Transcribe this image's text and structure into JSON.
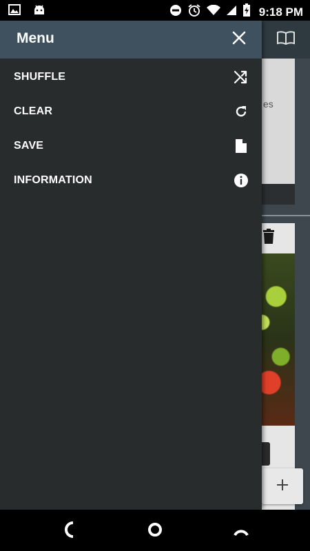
{
  "status_bar": {
    "time": "9:18 PM",
    "left_icons": [
      "image-icon",
      "android-icon"
    ],
    "right_icons": [
      "do-not-disturb-icon",
      "alarm-icon",
      "wifi-icon",
      "signal-icon",
      "battery-icon"
    ]
  },
  "drawer": {
    "title": "Menu",
    "close_icon": "close-icon",
    "items": [
      {
        "label": "SHUFFLE",
        "icon": "shuffle-icon"
      },
      {
        "label": "CLEAR",
        "icon": "refresh-icon"
      },
      {
        "label": "SAVE",
        "icon": "file-icon"
      },
      {
        "label": "INFORMATION",
        "icon": "info-icon"
      }
    ]
  },
  "background_app": {
    "book_icon": "book-icon",
    "card_snippet": "es",
    "add_icon": "plus-icon"
  },
  "nav_bar": {
    "icons": [
      "back-icon",
      "home-icon",
      "recents-icon"
    ]
  },
  "colors": {
    "drawer_bg": "#292c2d",
    "header_bg": "#3f505e",
    "text": "#ffffff"
  }
}
